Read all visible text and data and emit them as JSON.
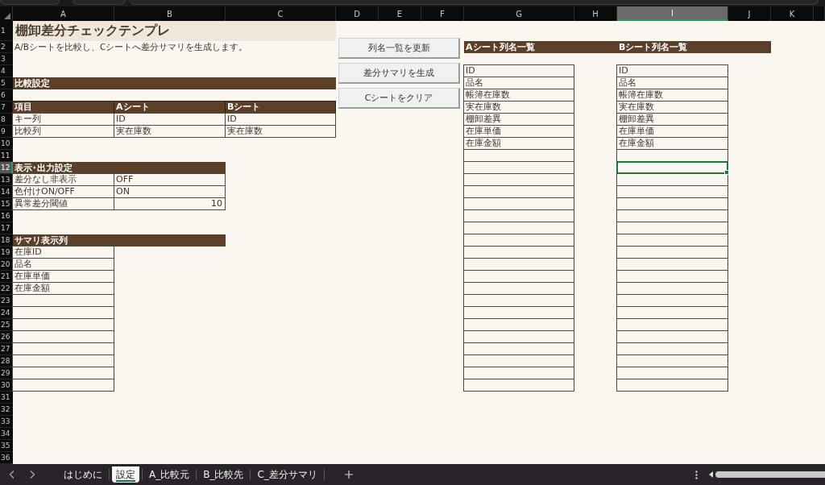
{
  "sheet": {
    "column_headers": [
      {
        "label": "A",
        "selected": false
      },
      {
        "label": "B",
        "selected": false
      },
      {
        "label": "C",
        "selected": false
      },
      {
        "label": "D",
        "selected": false
      },
      {
        "label": "E",
        "selected": false
      },
      {
        "label": "F",
        "selected": false
      },
      {
        "label": "G",
        "selected": false
      },
      {
        "label": "H",
        "selected": false
      },
      {
        "label": "I",
        "selected": true
      },
      {
        "label": "J",
        "selected": false
      },
      {
        "label": "K",
        "selected": false
      }
    ],
    "row_numbers": [
      {
        "label": "1",
        "selected": false
      },
      {
        "label": "2",
        "selected": false
      },
      {
        "label": "3",
        "selected": false
      },
      {
        "label": "4",
        "selected": false
      },
      {
        "label": "5",
        "selected": false
      },
      {
        "label": "6",
        "selected": false
      },
      {
        "label": "7",
        "selected": false
      },
      {
        "label": "8",
        "selected": false
      },
      {
        "label": "9",
        "selected": false
      },
      {
        "label": "10",
        "selected": false
      },
      {
        "label": "11",
        "selected": false
      },
      {
        "label": "12",
        "selected": true
      },
      {
        "label": "13",
        "selected": false
      },
      {
        "label": "14",
        "selected": false
      },
      {
        "label": "15",
        "selected": false
      },
      {
        "label": "16",
        "selected": false
      },
      {
        "label": "17",
        "selected": false
      },
      {
        "label": "18",
        "selected": false
      },
      {
        "label": "19",
        "selected": false
      },
      {
        "label": "20",
        "selected": false
      },
      {
        "label": "21",
        "selected": false
      },
      {
        "label": "22",
        "selected": false
      },
      {
        "label": "23",
        "selected": false
      },
      {
        "label": "24",
        "selected": false
      },
      {
        "label": "25",
        "selected": false
      },
      {
        "label": "26",
        "selected": false
      },
      {
        "label": "27",
        "selected": false
      },
      {
        "label": "28",
        "selected": false
      },
      {
        "label": "29",
        "selected": false
      },
      {
        "label": "30",
        "selected": false
      },
      {
        "label": "31",
        "selected": false
      },
      {
        "label": "32",
        "selected": false
      },
      {
        "label": "33",
        "selected": false
      },
      {
        "label": "34",
        "selected": false
      },
      {
        "label": "35",
        "selected": false
      },
      {
        "label": "36",
        "selected": false
      }
    ],
    "title": "棚卸差分チェックテンプレ",
    "description": "A/Bシートを比較し、Cシートへ差分サマリを生成します。",
    "comparison_settings": {
      "heading": "比較設定",
      "columns": [
        "項目",
        "Aシート",
        "Bシート"
      ],
      "rows": [
        {
          "item": "キー列",
          "a_sheet": "ID",
          "b_sheet": "ID"
        },
        {
          "item": "比較列",
          "a_sheet": "実在庫数",
          "b_sheet": "実在庫数"
        }
      ]
    },
    "display_settings": {
      "heading": "表示･出力設定",
      "rows": [
        {
          "label": "差分なし非表示",
          "value": "OFF",
          "kind": "text"
        },
        {
          "label": "色付けON/OFF",
          "value": "ON",
          "kind": "text"
        },
        {
          "label": "異常差分閾値",
          "value": "10",
          "kind": "number"
        }
      ]
    },
    "summary_columns": {
      "heading": "サマリ表示列",
      "items": [
        "在庫ID",
        "品名",
        "在庫単価",
        "在庫金額"
      ]
    },
    "a_sheet_columns": {
      "heading": "Aシート列名一覧",
      "items": [
        "ID",
        "品名",
        "帳簿在庫数",
        "実在庫数",
        "棚卸差異",
        "在庫単価",
        "在庫金額"
      ]
    },
    "b_sheet_columns": {
      "heading": "Bシート列名一覧",
      "items": [
        "ID",
        "品名",
        "帳簿在庫数",
        "実在庫数",
        "棚卸差異",
        "在庫単価",
        "在庫金額"
      ]
    }
  },
  "buttons": [
    "列名一覧を更新",
    "差分サマリを生成",
    "Cシートをクリア"
  ],
  "sheet_tabs": [
    {
      "label": "はじめに",
      "selected": false
    },
    {
      "label": "設定",
      "selected": true
    },
    {
      "label": "A_比較元",
      "selected": false
    },
    {
      "label": "B_比較先",
      "selected": false
    },
    {
      "label": "C_差分サマリ",
      "selected": false
    }
  ]
}
